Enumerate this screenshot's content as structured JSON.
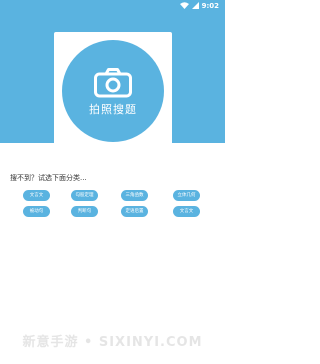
{
  "status_bar": {
    "wifi_icon": "wifi-icon",
    "signal_icon": "signal-icon",
    "time": "9:02"
  },
  "hero": {
    "button_label": "拍照搜题",
    "camera_icon": "camera-icon"
  },
  "prompt": "搜不到？试选下面分类...",
  "chips": {
    "row1": [
      "文言文",
      "勾股定理",
      "三角函数",
      "立体几何"
    ],
    "row2": [
      "被动句",
      "判断句",
      "定语后置",
      "文言文"
    ]
  },
  "watermark": "新意手游 • SIXINYI.COM",
  "colors": {
    "accent": "#5ab3e0",
    "background": "#ffffff"
  }
}
